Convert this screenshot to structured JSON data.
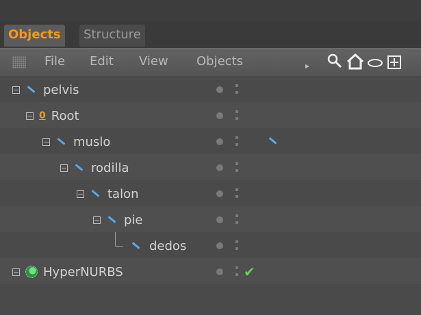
{
  "tabs": [
    {
      "label": "Objects"
    },
    {
      "label": "Structure"
    }
  ],
  "menu": [
    "File",
    "Edit",
    "View",
    "Objects"
  ],
  "toolbar": {
    "arrow": "▸",
    "search": "search-icon",
    "home": "home-icon",
    "eye": "eye-icon",
    "add": "add-icon"
  },
  "tree": [
    {
      "label": "pelvis",
      "depth": 0
    },
    {
      "label": "Root",
      "depth": 1,
      "icon": "null-object-icon",
      "sub": "0"
    },
    {
      "label": "muslo",
      "depth": 2
    },
    {
      "label": "rodilla",
      "depth": 3
    },
    {
      "label": "talon",
      "depth": 4
    },
    {
      "label": "pie",
      "depth": 5
    },
    {
      "label": "dedos",
      "depth": 6
    },
    {
      "label": "HyperNURBS",
      "depth": 0,
      "icon": "hypernurbs-icon",
      "checked": true
    }
  ],
  "colors": {
    "accent": "#f39a16",
    "pen": "#5aa9e8",
    "check": "#66d05f"
  }
}
